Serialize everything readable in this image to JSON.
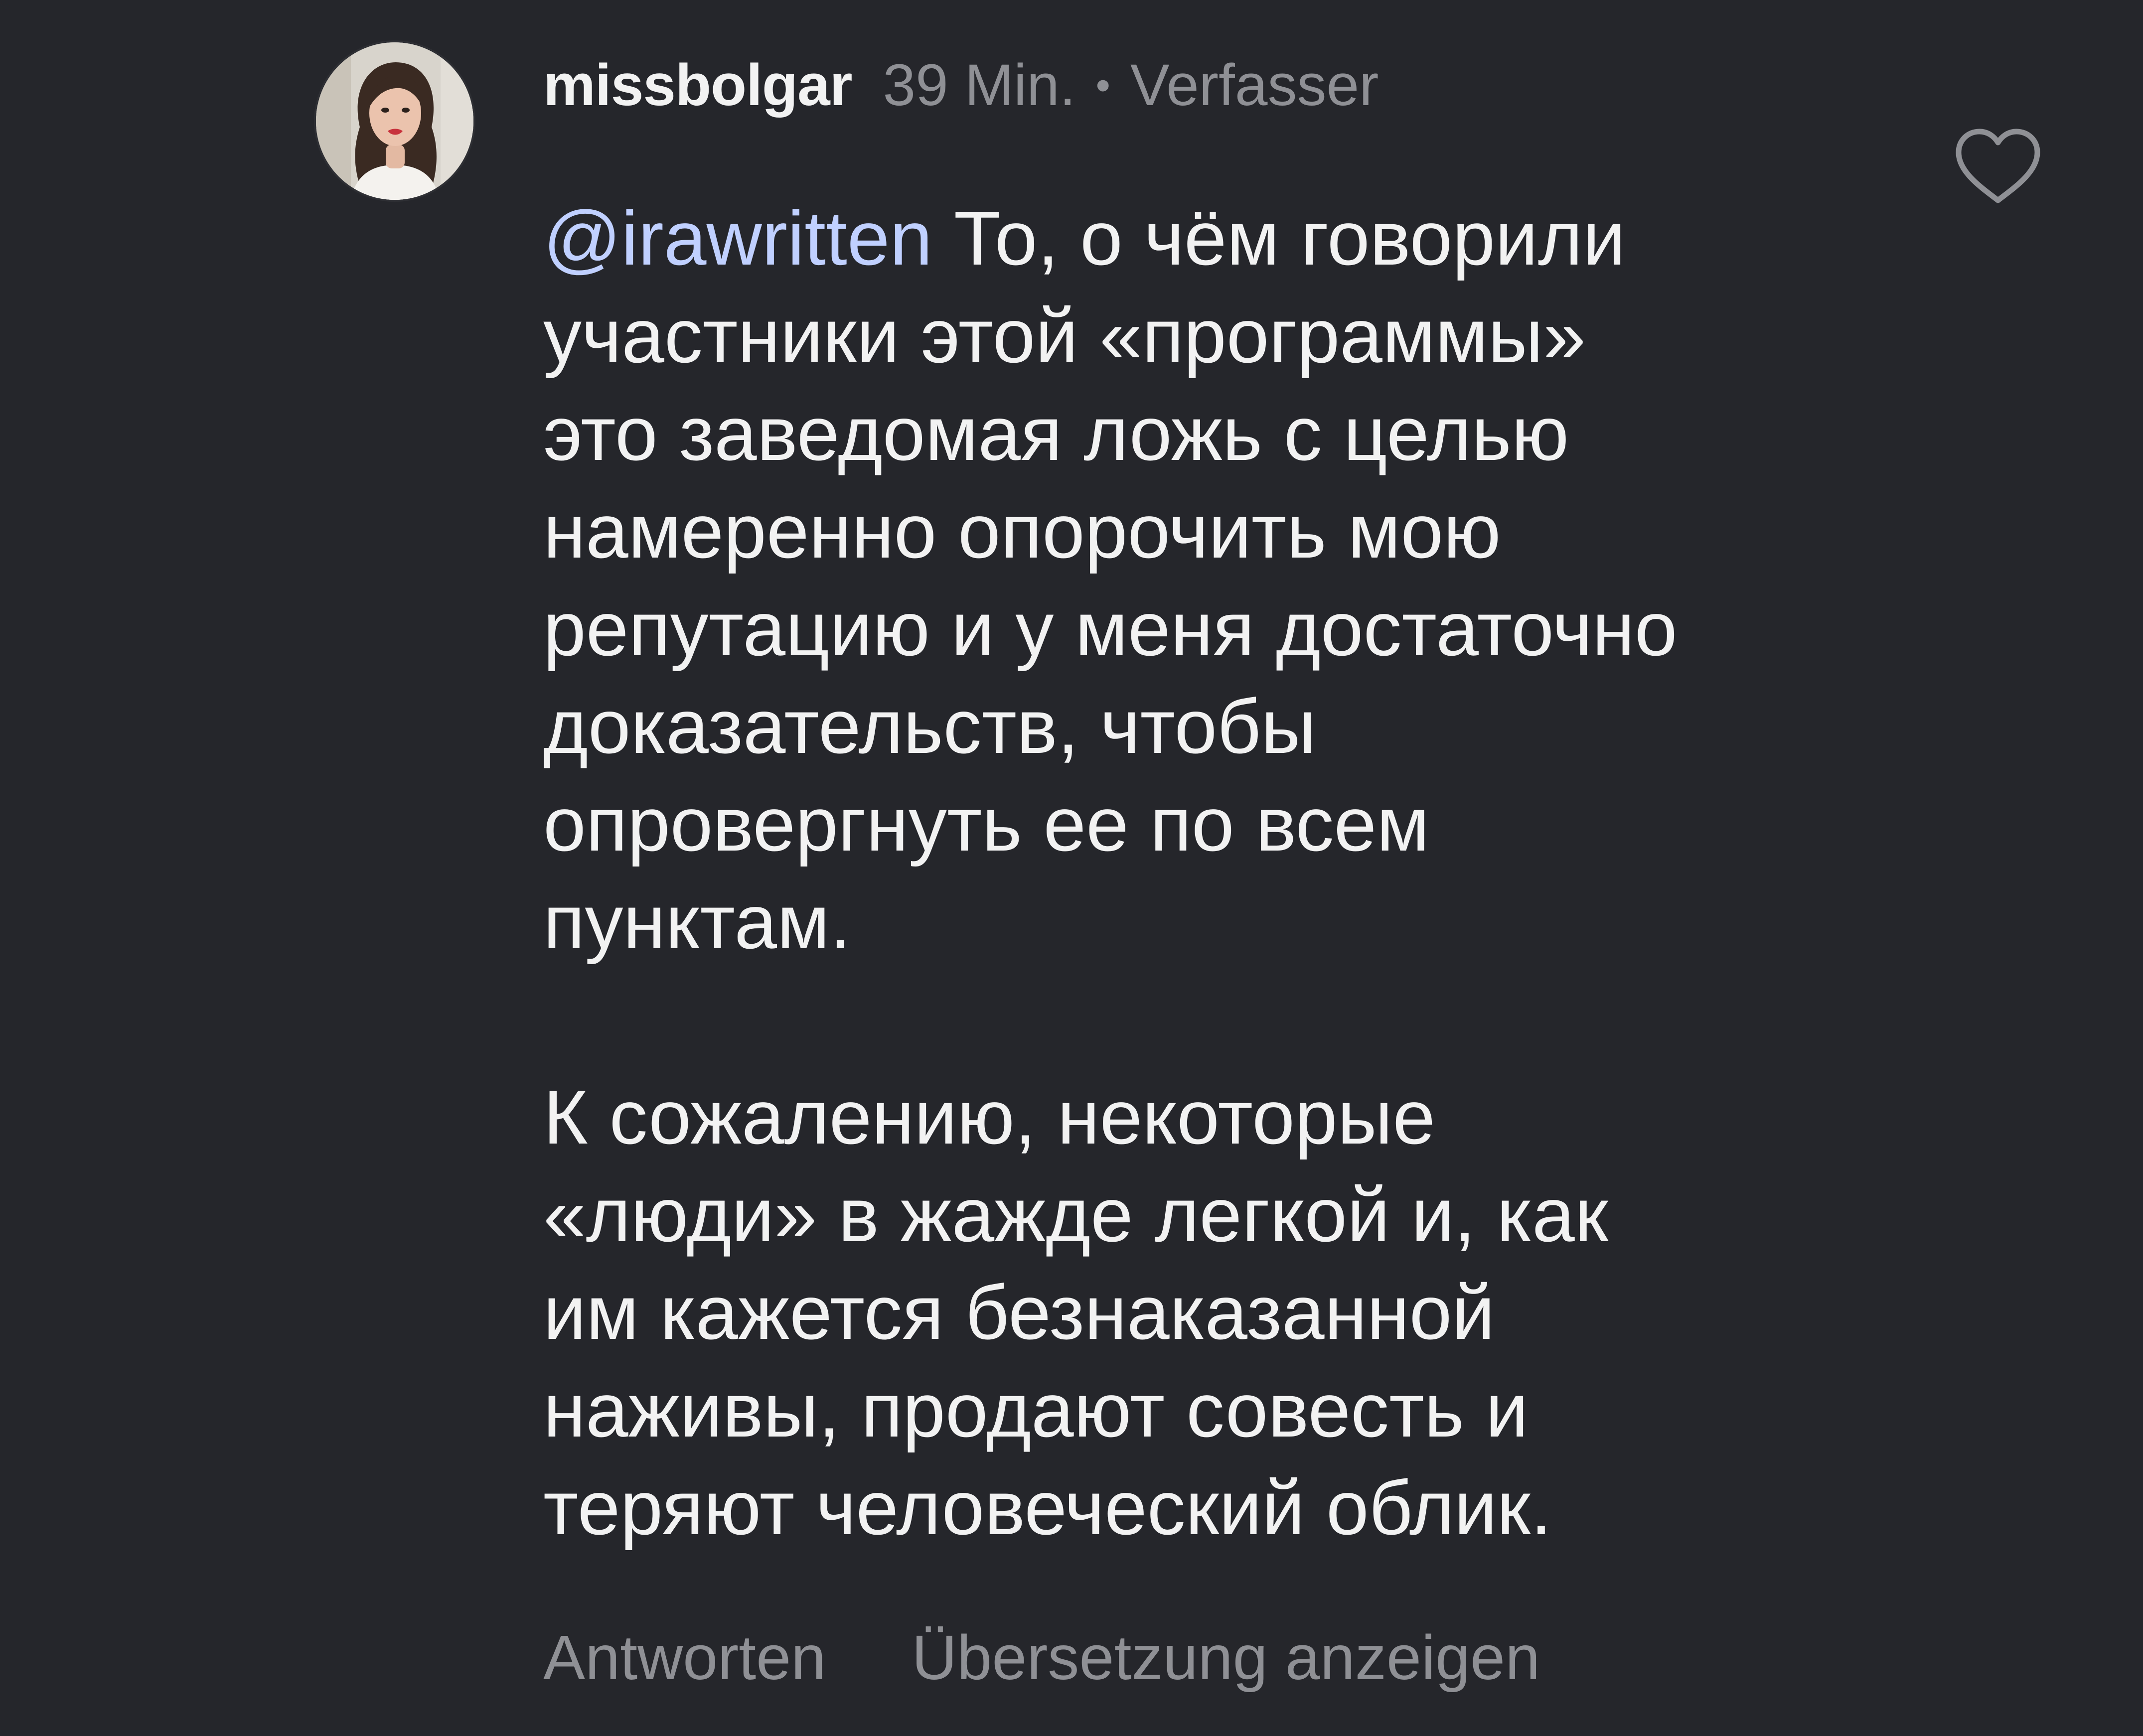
{
  "comment": {
    "author": {
      "username": "missbolgar",
      "time": "39 Min.",
      "separator": "•",
      "role": "Verfasser"
    },
    "mention": "@irawritten",
    "first_line_rest": " То, о чём говорили",
    "paragraph1_lines": [
      "участники этой «программы»",
      "это заведомая ложь с целью",
      "намеренно опорочить мою",
      "репутацию и у меня достаточно",
      "доказательств, чтобы",
      "опровергнуть ее по всем",
      "пунктам."
    ],
    "paragraph2_lines": [
      "К сожалению, некоторые",
      "«люди» в жажде легкой и, как",
      "им кажется безнаказанной",
      "наживы, продают совесть и",
      "теряют человеческий облик."
    ],
    "actions": {
      "reply": "Antworten",
      "translate": "Übersetzung anzeigen"
    },
    "icons": {
      "like": "heart-outline-icon"
    }
  },
  "colors": {
    "background": "#25262b",
    "text": "#f2f2f2",
    "muted": "#8f9095",
    "mention": "#c0d0ff"
  }
}
